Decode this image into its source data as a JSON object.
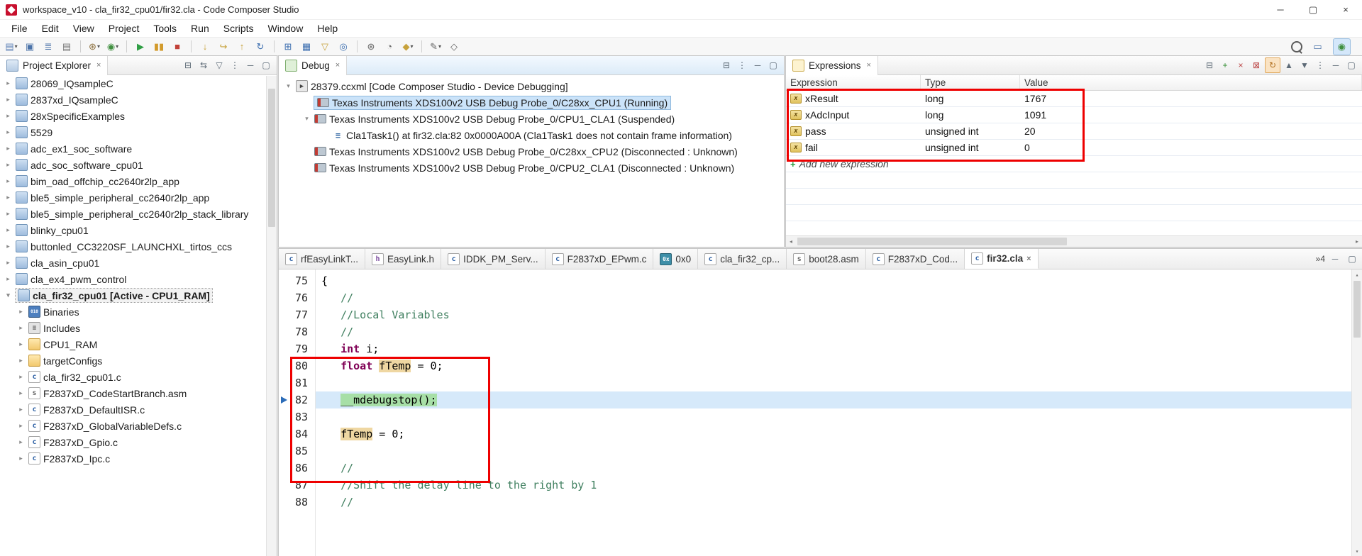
{
  "window": {
    "title": "workspace_v10 - cla_fir32_cpu01/fir32.cla - Code Composer Studio",
    "controls": {
      "minimize": "─",
      "maximize": "▢",
      "close": "×"
    }
  },
  "menu": [
    "File",
    "Edit",
    "View",
    "Project",
    "Tools",
    "Run",
    "Scripts",
    "Window",
    "Help"
  ],
  "toolbar": {
    "dropdown_glyph": "▾",
    "items": [
      {
        "name": "new-file-icon",
        "glyph": "▤",
        "color": "#5a7fb5",
        "dropdown": true
      },
      {
        "name": "save-icon",
        "glyph": "▣",
        "color": "#4a72a8"
      },
      {
        "name": "save-all-icon",
        "glyph": "≣",
        "color": "#4a72a8"
      },
      {
        "name": "print-icon",
        "glyph": "▤",
        "color": "#777777"
      },
      {
        "sep": true
      },
      {
        "name": "build-icon",
        "glyph": "⊛",
        "color": "#8a6d3b",
        "dropdown": true
      },
      {
        "name": "debug-launch-icon",
        "glyph": "◉",
        "color": "#3f8f3f",
        "dropdown": true
      },
      {
        "sep": true
      },
      {
        "name": "resume-icon",
        "glyph": "▶",
        "color": "#2f9e44"
      },
      {
        "name": "suspend-icon",
        "glyph": "▮▮",
        "color": "#d29a2b"
      },
      {
        "name": "terminate-icon",
        "glyph": "■",
        "color": "#c14138"
      },
      {
        "sep": true
      },
      {
        "name": "step-into-icon",
        "glyph": "↓",
        "color": "#c7a23c"
      },
      {
        "name": "step-over-icon",
        "glyph": "↪",
        "color": "#c7a23c"
      },
      {
        "name": "step-return-icon",
        "glyph": "↑",
        "color": "#c7a23c"
      },
      {
        "name": "restart-icon",
        "glyph": "↻",
        "color": "#3d6fb0"
      },
      {
        "sep": true
      },
      {
        "name": "registers-icon",
        "glyph": "⊞",
        "color": "#3d6fb0"
      },
      {
        "name": "memory-browser-icon",
        "glyph": "▦",
        "color": "#3d6fb0"
      },
      {
        "name": "filter-icon",
        "glyph": "▽",
        "color": "#c7a23c"
      },
      {
        "name": "breakpoints-icon",
        "glyph": "◎",
        "color": "#3d6fb0"
      },
      {
        "sep": true
      },
      {
        "name": "target-config-icon",
        "glyph": "⊛",
        "color": "#666666"
      },
      {
        "name": "profile-clock-icon",
        "glyph": "◔",
        "color": "#666666"
      },
      {
        "name": "variables-icon",
        "glyph": "◆",
        "color": "#c7a23c",
        "dropdown": true
      },
      {
        "sep": true
      },
      {
        "name": "annotate-icon",
        "glyph": "✎",
        "color": "#666666",
        "dropdown": true
      },
      {
        "name": "pin-icon",
        "glyph": "◇",
        "color": "#666666"
      }
    ],
    "right": [
      {
        "name": "search-icon",
        "type": "magnifier"
      },
      {
        "name": "edit-perspective-icon",
        "glyph": "▭",
        "color": "#4a72a8"
      },
      {
        "name": "debug-perspective-icon",
        "glyph": "◉",
        "color": "#3f8f3f",
        "active": true
      }
    ]
  },
  "icon_glyphs": {
    "project": "",
    "folder": "",
    "binaries": "010",
    "includes": "≡",
    "c-file": "c",
    "h-file": "h",
    "asm-file": "s",
    "memory": "0x",
    "explorer": "▤",
    "debugview": "◉",
    "expr": "x=",
    "debug-target": "▶"
  },
  "project_explorer": {
    "title": "Project Explorer",
    "tab_close": "×",
    "header_icons": [
      {
        "name": "collapse-all-icon",
        "glyph": "⊟"
      },
      {
        "name": "link-editor-icon",
        "glyph": "⇆"
      },
      {
        "name": "filter-icon",
        "glyph": "▽"
      },
      {
        "name": "view-menu-icon",
        "glyph": "⋮"
      },
      {
        "name": "minimize-icon",
        "glyph": "─"
      },
      {
        "name": "maximize-icon",
        "glyph": "▢"
      }
    ],
    "items": [
      {
        "label": "28069_IQsampleC",
        "level": 0,
        "arrow": "collapsed",
        "icon": "project"
      },
      {
        "label": "2837xd_IQsampleC",
        "level": 0,
        "arrow": "collapsed",
        "icon": "project"
      },
      {
        "label": "28xSpecificExamples",
        "level": 0,
        "arrow": "collapsed",
        "icon": "project"
      },
      {
        "label": "5529",
        "level": 0,
        "arrow": "collapsed",
        "icon": "project"
      },
      {
        "label": "adc_ex1_soc_software",
        "level": 0,
        "arrow": "collapsed",
        "icon": "project"
      },
      {
        "label": "adc_soc_software_cpu01",
        "level": 0,
        "arrow": "collapsed",
        "icon": "project"
      },
      {
        "label": "bim_oad_offchip_cc2640r2lp_app",
        "level": 0,
        "arrow": "collapsed",
        "icon": "project"
      },
      {
        "label": "ble5_simple_peripheral_cc2640r2lp_app",
        "level": 0,
        "arrow": "collapsed",
        "icon": "project"
      },
      {
        "label": "ble5_simple_peripheral_cc2640r2lp_stack_library",
        "level": 0,
        "arrow": "collapsed",
        "icon": "project"
      },
      {
        "label": "blinky_cpu01",
        "level": 0,
        "arrow": "collapsed",
        "icon": "project"
      },
      {
        "label": "buttonled_CC3220SF_LAUNCHXL_tirtos_ccs",
        "level": 0,
        "arrow": "collapsed",
        "icon": "project"
      },
      {
        "label": "cla_asin_cpu01",
        "level": 0,
        "arrow": "collapsed",
        "icon": "project"
      },
      {
        "label": "cla_ex4_pwm_control",
        "level": 0,
        "arrow": "collapsed",
        "icon": "project"
      },
      {
        "label": "cla_fir32_cpu01",
        "suffix": "  [Active - CPU1_RAM]",
        "level": 0,
        "arrow": "expanded",
        "icon": "project",
        "bold": true,
        "soft_selected": true
      },
      {
        "label": "Binaries",
        "level": 1,
        "arrow": "collapsed",
        "icon": "binaries"
      },
      {
        "label": "Includes",
        "level": 1,
        "arrow": "collapsed",
        "icon": "includes"
      },
      {
        "label": "CPU1_RAM",
        "level": 1,
        "arrow": "collapsed",
        "icon": "folder"
      },
      {
        "label": "targetConfigs",
        "level": 1,
        "arrow": "collapsed",
        "icon": "folder"
      },
      {
        "label": "cla_fir32_cpu01.c",
        "level": 1,
        "arrow": "collapsed",
        "icon": "c-file"
      },
      {
        "label": "F2837xD_CodeStartBranch.asm",
        "level": 1,
        "arrow": "collapsed",
        "icon": "asm-file"
      },
      {
        "label": "F2837xD_DefaultISR.c",
        "level": 1,
        "arrow": "collapsed",
        "icon": "c-file"
      },
      {
        "label": "F2837xD_GlobalVariableDefs.c",
        "level": 1,
        "arrow": "collapsed",
        "icon": "c-file"
      },
      {
        "label": "F2837xD_Gpio.c",
        "level": 1,
        "arrow": "collapsed",
        "icon": "c-file"
      },
      {
        "label": "F2837xD_Ipc.c",
        "level": 1,
        "arrow": "collapsed",
        "icon": "c-file"
      }
    ]
  },
  "debug_panel": {
    "title": "Debug",
    "tab_close": "×",
    "header_icons": [
      {
        "name": "collapse-all-icon",
        "glyph": "⊟"
      },
      {
        "name": "view-menu-icon",
        "glyph": "⋮"
      },
      {
        "name": "minimize-icon",
        "glyph": "─"
      },
      {
        "name": "maximize-icon",
        "glyph": "▢"
      }
    ],
    "nodes": [
      {
        "label": "28379.ccxml [Code Composer Studio - Device Debugging]",
        "level": 0,
        "arrow": "expanded",
        "icon": "debug-target"
      },
      {
        "label": "Texas Instruments XDS100v2 USB Debug Probe_0/C28xx_CPU1 (Running)",
        "level": 1,
        "arrow": "none",
        "icon": "probe",
        "selected": true
      },
      {
        "label": "Texas Instruments XDS100v2 USB Debug Probe_0/CPU1_CLA1 (Suspended)",
        "level": 1,
        "arrow": "expanded",
        "icon": "probe"
      },
      {
        "label": "Cla1Task1() at fir32.cla:82 0x0000A00A  (Cla1Task1 does not contain frame information)",
        "level": 2,
        "arrow": "none",
        "icon": "stack-frame"
      },
      {
        "label": "Texas Instruments XDS100v2 USB Debug Probe_0/C28xx_CPU2 (Disconnected : Unknown)",
        "level": 1,
        "arrow": "none",
        "icon": "probe"
      },
      {
        "label": "Texas Instruments XDS100v2 USB Debug Probe_0/CPU2_CLA1 (Disconnected : Unknown)",
        "level": 1,
        "arrow": "none",
        "icon": "probe"
      }
    ]
  },
  "expressions": {
    "title": "Expressions",
    "tab_close": "×",
    "header_icons": [
      {
        "name": "collapse-all-icon",
        "glyph": "⊟"
      },
      {
        "name": "add-expression-icon",
        "glyph": "+",
        "cls": "green"
      },
      {
        "name": "remove-expression-icon",
        "glyph": "×",
        "cls": "red"
      },
      {
        "name": "remove-all-icon",
        "glyph": "⊠",
        "cls": "red"
      },
      {
        "name": "refresh-icon",
        "glyph": "↻",
        "cls": "orange-hl"
      },
      {
        "name": "import-icon",
        "glyph": "▲"
      },
      {
        "name": "export-icon",
        "glyph": "▼"
      },
      {
        "name": "view-menu-icon",
        "glyph": "⋮"
      },
      {
        "name": "minimize-icon",
        "glyph": "─"
      },
      {
        "name": "maximize-icon",
        "glyph": "▢"
      }
    ],
    "columns": [
      "Expression",
      "Type",
      "Value"
    ],
    "rows": [
      {
        "expression": "xResult",
        "type": "long",
        "value": "1767"
      },
      {
        "expression": "xAdcInput",
        "type": "long",
        "value": "1091"
      },
      {
        "expression": "pass",
        "type": "unsigned int",
        "value": "20"
      },
      {
        "expression": "fail",
        "type": "unsigned int",
        "value": "0"
      }
    ],
    "empty_row_count": 4,
    "add_row_label": "Add new expression"
  },
  "editor": {
    "tabs": [
      {
        "label": "rfEasyLinkT...",
        "icon": "c-file"
      },
      {
        "label": "EasyLink.h",
        "icon": "h-file"
      },
      {
        "label": "IDDK_PM_Serv...",
        "icon": "c-file"
      },
      {
        "label": "F2837xD_EPwm.c",
        "icon": "c-file"
      },
      {
        "label": "0x0",
        "icon": "memory"
      },
      {
        "label": "cla_fir32_cp...",
        "icon": "c-file"
      },
      {
        "label": "boot28.asm",
        "icon": "asm-file"
      },
      {
        "label": "F2837xD_Cod...",
        "icon": "c-file"
      },
      {
        "label": "fir32.cla",
        "icon": "c-file",
        "active": true,
        "close": "×"
      }
    ],
    "tab_overflow": "»4",
    "header_icons": [
      {
        "name": "minimize-icon",
        "glyph": "─"
      },
      {
        "name": "maximize-icon",
        "glyph": "▢"
      }
    ],
    "code": {
      "lines": [
        {
          "num": "75",
          "tokens": [
            {
              "t": "{",
              "s": "plain"
            }
          ]
        },
        {
          "num": "76",
          "tokens": [
            {
              "t": "   //",
              "s": "comment"
            }
          ]
        },
        {
          "num": "77",
          "tokens": [
            {
              "t": "   //Local Variables",
              "s": "comment"
            }
          ]
        },
        {
          "num": "78",
          "tokens": [
            {
              "t": "   //",
              "s": "comment"
            }
          ]
        },
        {
          "num": "79",
          "tokens": [
            {
              "t": "   ",
              "s": "plain"
            },
            {
              "t": "int",
              "s": "keyword"
            },
            {
              "t": " i;",
              "s": "plain"
            }
          ]
        },
        {
          "num": "80",
          "tokens": [
            {
              "t": "   ",
              "s": "plain"
            },
            {
              "t": "float",
              "s": "keyword"
            },
            {
              "t": " ",
              "s": "plain"
            },
            {
              "t": "fTemp",
              "s": "occurrence"
            },
            {
              "t": " = 0;",
              "s": "plain"
            }
          ]
        },
        {
          "num": "81",
          "tokens": []
        },
        {
          "num": "82",
          "debug": true,
          "tokens": [
            {
              "t": "   ",
              "s": "plain"
            },
            {
              "t": "__mdebugstop();",
              "s": "debug-token"
            }
          ]
        },
        {
          "num": "83",
          "tokens": []
        },
        {
          "num": "84",
          "tokens": [
            {
              "t": "   ",
              "s": "plain"
            },
            {
              "t": "fTemp",
              "s": "occurrence"
            },
            {
              "t": " = 0;",
              "s": "plain"
            }
          ]
        },
        {
          "num": "85",
          "tokens": []
        },
        {
          "num": "86",
          "tokens": [
            {
              "t": "   //",
              "s": "comment"
            }
          ]
        },
        {
          "num": "87",
          "tokens": [
            {
              "t": "   //Shift the delay line to the right by 1",
              "s": "comment"
            }
          ]
        },
        {
          "num": "88",
          "tokens": [
            {
              "t": "   //",
              "s": "comment"
            }
          ]
        }
      ]
    }
  },
  "colors": {
    "annotation_red": "#ee0000",
    "comment_green": "#3f7f5f",
    "keyword_purple": "#7f0055",
    "occurrence_bg": "#efd7a2",
    "debug_line_bg": "#d6e9fa",
    "debug_token_bg": "#a7dfa7",
    "selection_blue": "#cbe3f9"
  }
}
